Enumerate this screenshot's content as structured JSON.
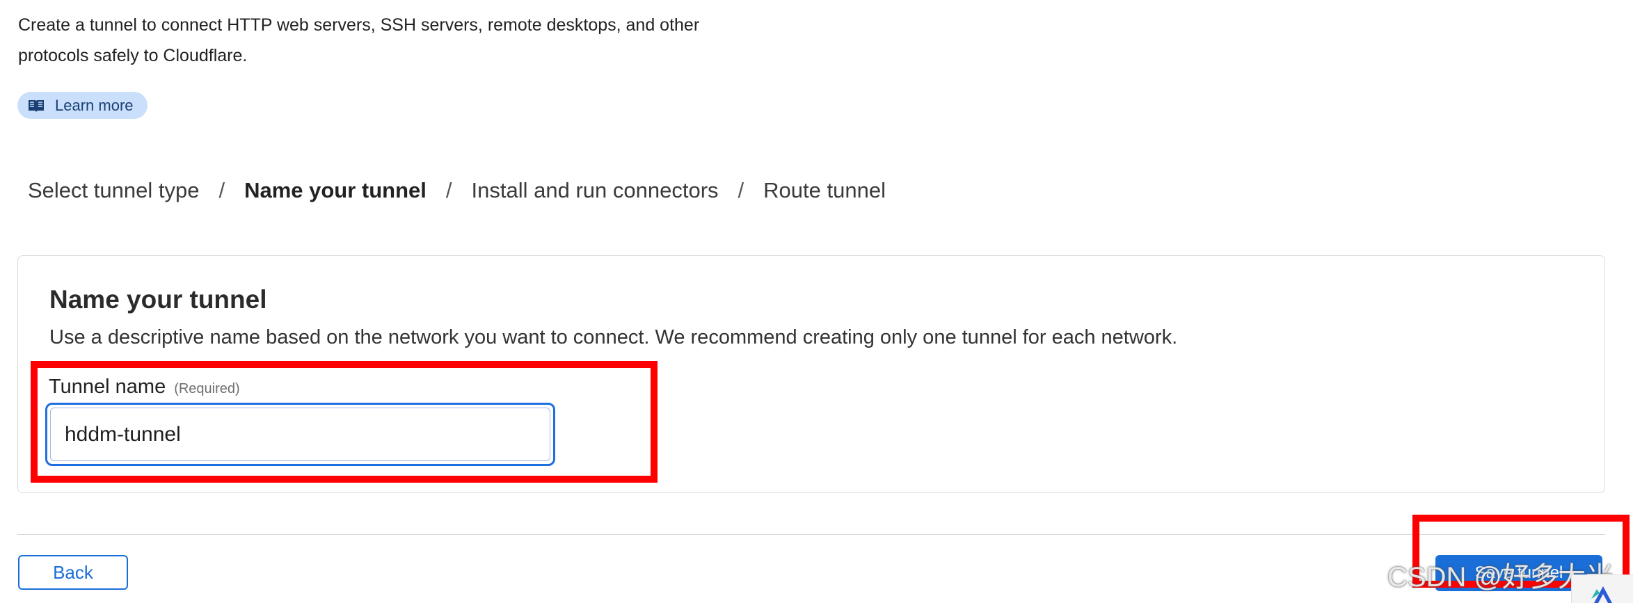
{
  "intro": {
    "line1": "Create a tunnel to connect HTTP web servers, SSH servers, remote desktops, and other",
    "line2": "protocols safely to Cloudflare."
  },
  "learn_more": {
    "label": "Learn more",
    "icon": "book-icon"
  },
  "breadcrumb": {
    "steps": [
      "Select tunnel type",
      "Name your tunnel",
      "Install and run connectors",
      "Route tunnel"
    ],
    "separator": "/",
    "current_index": 1
  },
  "card": {
    "title": "Name your tunnel",
    "description": "Use a descriptive name based on the network you want to connect. We recommend creating only one tunnel for each network."
  },
  "tunnel_name_field": {
    "label": "Tunnel name",
    "required_text": "(Required)",
    "value": "hddm-tunnel"
  },
  "footer": {
    "back_label": "Back",
    "save_label": "Save tunnel"
  },
  "watermark": "CSDN @好多大米",
  "colors": {
    "accent": "#1a6ed8",
    "highlight": "#ff0000",
    "learn_more_bg": "#c9dffb"
  }
}
